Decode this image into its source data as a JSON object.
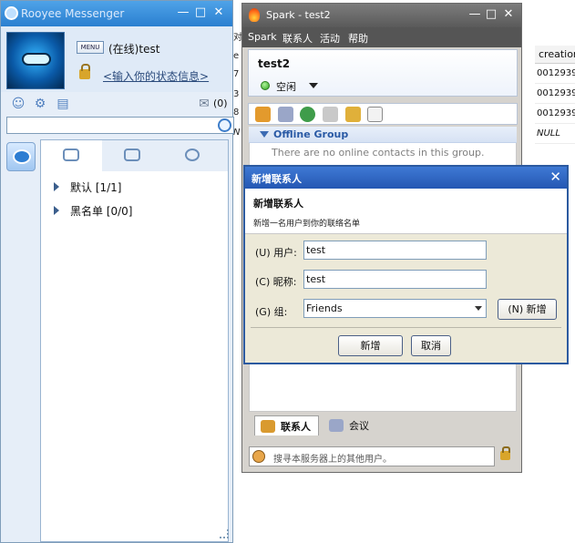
{
  "rooyee": {
    "title": "Rooyee Messenger",
    "menu_label": "MENU",
    "status": "(在线)test",
    "status_link": "<输入你的状态信息>",
    "mail_count": "(0)",
    "groups": [
      {
        "label": "默认 [1/1]"
      },
      {
        "label": "黑名单 [0/0]"
      }
    ]
  },
  "spark": {
    "title": "Spark - test2",
    "menu": [
      "Spark",
      "联系人",
      "活动",
      "帮助"
    ],
    "username": "test2",
    "presence": "空闲",
    "group_name": "Offline Group",
    "empty_message": "There are no online contacts in this group.",
    "tabs": [
      {
        "label": "联系人"
      },
      {
        "label": "会议"
      }
    ],
    "search_placeholder": "搜寻本服务器上的其他用户。"
  },
  "dialog": {
    "title": "新增联系人",
    "heading": "新增联系人",
    "subheading": "新增一名用户到你的联络名单",
    "user_label": "(U) 用户:",
    "user_value": "test",
    "nick_label": "(C) 昵称:",
    "nick_value": "test",
    "group_label": "(G) 组:",
    "group_value": "Friends",
    "new_group_button": "(N) 新增",
    "ok_button": "新增",
    "cancel_button": "取消"
  },
  "background_table": {
    "left_headers": [
      "对",
      "e",
      "7",
      "3",
      "8",
      "N"
    ],
    "column_header": "creation",
    "rows": [
      "0012939",
      "0012939",
      "0012939",
      "NULL"
    ]
  },
  "colors": {
    "rooyee_title": "#2a7fd0",
    "spark_menubar": "#555555",
    "dialog_title": "#2457b3",
    "group_header_text": "#2a5aa5"
  }
}
